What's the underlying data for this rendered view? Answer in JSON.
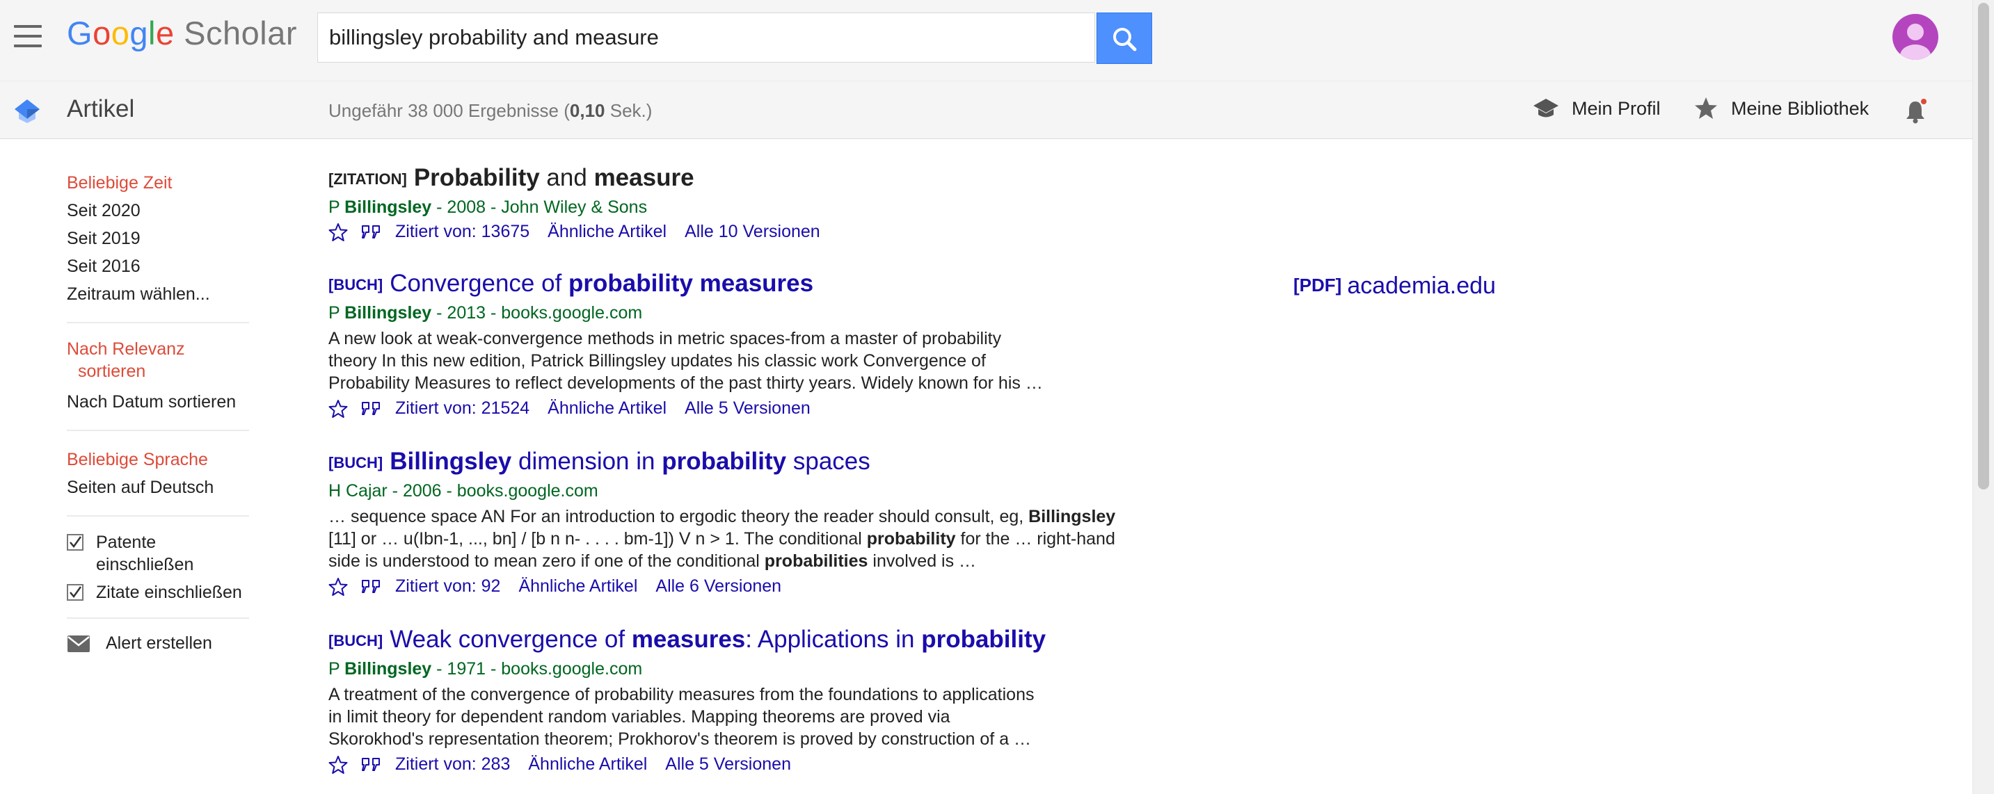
{
  "header": {
    "logo_google": "Google",
    "logo_scholar": "Scholar",
    "search_value": "billingsley probability and measure"
  },
  "subbar": {
    "section_title": "Artikel",
    "stats_prefix": "Ungefähr 38 000 Ergebnisse (",
    "stats_time": "0,10",
    "stats_suffix": " Sek.)",
    "my_profile": "Mein Profil",
    "my_library": "Meine Bibliothek"
  },
  "sidebar": {
    "time_filters": [
      "Beliebige Zeit",
      "Seit 2020",
      "Seit 2019",
      "Seit 2016",
      "Zeitraum wählen..."
    ],
    "sort_relevance_1": "Nach Relevanz",
    "sort_relevance_2": "sortieren",
    "sort_date": "Nach Datum sortieren",
    "lang_any": "Beliebige Sprache",
    "lang_de": "Seiten auf Deutsch",
    "patents_1": "Patente",
    "patents_2": "einschließen",
    "citations": "Zitate einschließen",
    "alert": "Alert erstellen"
  },
  "results": [
    {
      "type": "[ZITATION]",
      "title_parts": [
        [
          "Probability",
          true
        ],
        [
          " and ",
          false
        ],
        [
          "measure",
          true
        ]
      ],
      "author_initial": "P ",
      "author_bold": "Billingsley",
      "meta_rest": " - 2008 - John Wiley & Sons",
      "snippet": [],
      "cited": "Zitiert von: 13675",
      "related": "Ähnliche Artikel",
      "versions": "Alle 10 Versionen"
    },
    {
      "type": "[BUCH]",
      "title_parts": [
        [
          "Convergence of ",
          false
        ],
        [
          "probability measures",
          true
        ]
      ],
      "author_initial": "P ",
      "author_bold": "Billingsley",
      "meta_rest": " - 2013 - books.google.com",
      "snippet": [
        [
          [
            "A new look at weak-convergence methods in metric spaces-from a master of probability",
            false
          ]
        ],
        [
          [
            "theory In this new edition, Patrick Billingsley updates his classic work Convergence of",
            false
          ]
        ],
        [
          [
            "Probability Measures to reflect developments of the past thirty years. Widely known for his …",
            false
          ]
        ]
      ],
      "cited": "Zitiert von: 21524",
      "related": "Ähnliche Artikel",
      "versions": "Alle 5 Versionen"
    },
    {
      "type": "[BUCH]",
      "title_parts": [
        [
          "Billingsley",
          true
        ],
        [
          " dimension in ",
          false
        ],
        [
          "probability",
          true
        ],
        [
          " spaces",
          false
        ]
      ],
      "author_initial": "",
      "author_bold": "",
      "meta_rest": "H Cajar - 2006 - books.google.com",
      "snippet": [
        [
          [
            "… sequence space AN For an introduction to ergodic theory the reader should consult, eg, ",
            false
          ],
          [
            "Billingsley",
            true
          ]
        ],
        [
          [
            "[11] or … u(Ibn-1, ..., bn] / [b n n- . . . . bm-1]) V n > 1. The conditional ",
            false
          ],
          [
            "probability",
            true
          ],
          [
            " for the … right-hand",
            false
          ]
        ],
        [
          [
            "side is understood to mean zero if one of the conditional ",
            false
          ],
          [
            "probabilities",
            true
          ],
          [
            " involved is …",
            false
          ]
        ]
      ],
      "cited": "Zitiert von: 92",
      "related": "Ähnliche Artikel",
      "versions": "Alle 6 Versionen"
    },
    {
      "type": "[BUCH]",
      "title_parts": [
        [
          "Weak convergence of ",
          false
        ],
        [
          "measures",
          true
        ],
        [
          ": Applications in ",
          false
        ],
        [
          "probability",
          true
        ]
      ],
      "author_initial": "P ",
      "author_bold": "Billingsley",
      "meta_rest": " - 1971 - books.google.com",
      "snippet": [
        [
          [
            "A treatment of the convergence of probability measures from the foundations to applications",
            false
          ]
        ],
        [
          [
            "in limit theory for dependent random variables. Mapping theorems are proved via",
            false
          ]
        ],
        [
          [
            "Skorokhod's representation theorem; Prokhorov's theorem is proved by construction of a …",
            false
          ]
        ]
      ],
      "cited": "Zitiert von: 283",
      "related": "Ähnliche Artikel",
      "versions": "Alle 5 Versionen"
    }
  ],
  "pdf_side_link": {
    "tag": "[PDF]",
    "label": "academia.edu"
  },
  "colors": {
    "accent": "#4d90fe",
    "link": "#1a0dab",
    "meta": "#006621",
    "selected": "#dd4b39",
    "avatar": "#b445bf"
  },
  "icons": [
    "menu-icon",
    "search-icon",
    "avatar-icon",
    "scholar-cap-icon",
    "profile-cap-icon",
    "star-icon",
    "bell-icon",
    "checkbox-icon",
    "mail-icon",
    "quote-icon"
  ]
}
